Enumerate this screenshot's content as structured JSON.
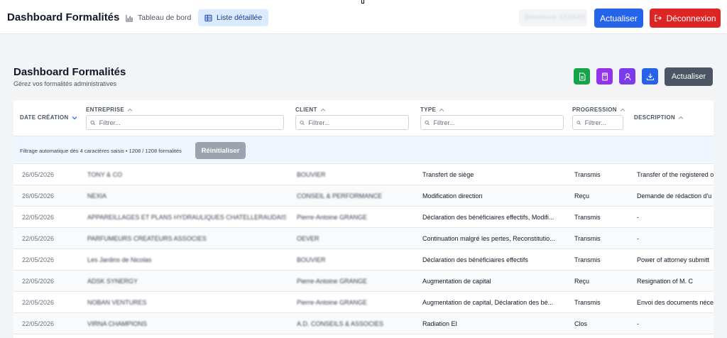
{
  "nav": {
    "brand": "Dashboard Formalités",
    "tabs": [
      {
        "label": "Tableau de bord",
        "icon": "bar-chart-icon",
        "active": false
      },
      {
        "label": "Liste détaillée",
        "icon": "table-icon",
        "active": true
      }
    ],
    "user_label": "Bienvenue XXXXXX",
    "refresh_label": "Actualiser",
    "logout_label": "Déconnexion"
  },
  "page": {
    "title": "Dashboard Formalités",
    "subtitle": "Gérez vos formalités administratives",
    "actions": [
      {
        "icon": "excel-file-icon",
        "color": "#16a34a"
      },
      {
        "icon": "calculator-icon",
        "color": "#9333ea"
      },
      {
        "icon": "user-icon",
        "color": "#7c3aed"
      },
      {
        "icon": "download-icon",
        "color": "#2563eb"
      }
    ],
    "refresh_label": "Actualiser"
  },
  "table": {
    "columns": {
      "date": "DATE CRÉATION",
      "entreprise": "ENTREPRISE",
      "client": "CLIENT",
      "type": "TYPE",
      "progression": "PROGRESSION",
      "description": "DESCRIPTION"
    },
    "filter_placeholder": "Filtrer...",
    "filter_message": "Filtrage automatique dès 4 caractères saisis • 1208 / 1208 formalités",
    "reset_label": "Réinitialiser",
    "rows": [
      {
        "date": "26/05/2026",
        "entreprise": "TONY & CO",
        "client": "BOUVIER",
        "type": "Transfert de siège",
        "progression": "Transmis",
        "description": "Transfer of the registered o"
      },
      {
        "date": "26/05/2026",
        "entreprise": "NEXIA",
        "client": "CONSEIL & PERFORMANCE",
        "type": "Modification direction",
        "progression": "Reçu",
        "description": "Demande de rédaction d'u"
      },
      {
        "date": "22/05/2026",
        "entreprise": "APPAREILLAGES ET PLANS HYDRAULIQUES CHATELLERAUDAIS",
        "client": "Pierre-Antoine GRANGE",
        "type": "Déclaration des bénéficiaires effectifs, Modifi...",
        "progression": "Transmis",
        "description": "-"
      },
      {
        "date": "22/05/2026",
        "entreprise": "PARFUMEURS CREATEURS ASSOCIES",
        "client": "OEVER",
        "type": "Continuation malgré les pertes, Reconstitutio...",
        "progression": "Transmis",
        "description": "-"
      },
      {
        "date": "22/05/2026",
        "entreprise": "Les Jardins de Nicolas",
        "client": "BOUVIER",
        "type": "Déclaration des bénéficiaires effectifs",
        "progression": "Transmis",
        "description": "Power of attorney submitt"
      },
      {
        "date": "22/05/2026",
        "entreprise": "ADSK SYNERGY",
        "client": "Pierre-Antoine GRANGE",
        "type": "Augmentation de capital",
        "progression": "Reçu",
        "description": "Resignation of M. C"
      },
      {
        "date": "22/05/2026",
        "entreprise": "NOBAN VENTURES",
        "client": "Pierre-Antoine GRANGE",
        "type": "Augmentation de capital, Déclaration des bé...",
        "progression": "Transmis",
        "description": "Envoi des documents néce"
      },
      {
        "date": "22/05/2026",
        "entreprise": "VIRNA CHAMPIONS",
        "client": "A.D. CONSEILS & ASSOCIES",
        "type": "Radiation EI",
        "progression": "Clos",
        "description": "-"
      }
    ]
  }
}
